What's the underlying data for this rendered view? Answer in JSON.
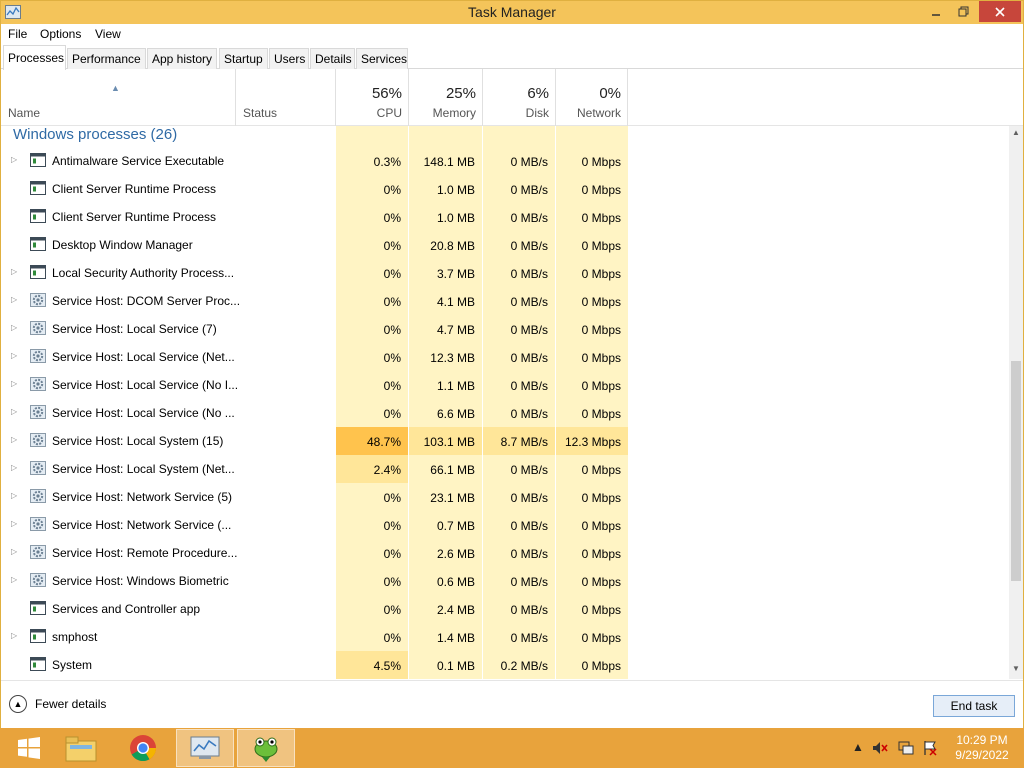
{
  "window": {
    "title": "Task Manager"
  },
  "menu": [
    "File",
    "Options",
    "View"
  ],
  "tabs": [
    "Processes",
    "Performance",
    "App history",
    "Startup",
    "Users",
    "Details",
    "Services"
  ],
  "columns": {
    "name": "Name",
    "status": "Status",
    "cpu": {
      "label": "CPU",
      "pct": "56%"
    },
    "memory": {
      "label": "Memory",
      "pct": "25%"
    },
    "disk": {
      "label": "Disk",
      "pct": "6%"
    },
    "network": {
      "label": "Network",
      "pct": "0%"
    }
  },
  "group": {
    "title": "Windows processes (26)"
  },
  "processes": [
    {
      "name": "Antimalware Service Executable",
      "cpu": "0.3%",
      "memory": "148.1 MB",
      "disk": "0 MB/s",
      "network": "0 Mbps",
      "expandable": true,
      "icon": "window-app-icon"
    },
    {
      "name": "Client Server Runtime Process",
      "cpu": "0%",
      "memory": "1.0 MB",
      "disk": "0 MB/s",
      "network": "0 Mbps",
      "expandable": false,
      "icon": "window-app-icon"
    },
    {
      "name": "Client Server Runtime Process",
      "cpu": "0%",
      "memory": "1.0 MB",
      "disk": "0 MB/s",
      "network": "0 Mbps",
      "expandable": false,
      "icon": "window-app-icon"
    },
    {
      "name": "Desktop Window Manager",
      "cpu": "0%",
      "memory": "20.8 MB",
      "disk": "0 MB/s",
      "network": "0 Mbps",
      "expandable": false,
      "icon": "window-app-icon"
    },
    {
      "name": "Local Security Authority Process...",
      "cpu": "0%",
      "memory": "3.7 MB",
      "disk": "0 MB/s",
      "network": "0 Mbps",
      "expandable": true,
      "icon": "window-app-icon"
    },
    {
      "name": "Service Host: DCOM Server Proc...",
      "cpu": "0%",
      "memory": "4.1 MB",
      "disk": "0 MB/s",
      "network": "0 Mbps",
      "expandable": true,
      "icon": "gear-icon"
    },
    {
      "name": "Service Host: Local Service (7)",
      "cpu": "0%",
      "memory": "4.7 MB",
      "disk": "0 MB/s",
      "network": "0 Mbps",
      "expandable": true,
      "icon": "gear-icon"
    },
    {
      "name": "Service Host: Local Service (Net...",
      "cpu": "0%",
      "memory": "12.3 MB",
      "disk": "0 MB/s",
      "network": "0 Mbps",
      "expandable": true,
      "icon": "gear-icon"
    },
    {
      "name": "Service Host: Local Service (No I...",
      "cpu": "0%",
      "memory": "1.1 MB",
      "disk": "0 MB/s",
      "network": "0 Mbps",
      "expandable": true,
      "icon": "gear-icon"
    },
    {
      "name": "Service Host: Local Service (No ...",
      "cpu": "0%",
      "memory": "6.6 MB",
      "disk": "0 MB/s",
      "network": "0 Mbps",
      "expandable": true,
      "icon": "gear-icon"
    },
    {
      "name": "Service Host: Local System (15)",
      "cpu": "48.7%",
      "memory": "103.1 MB",
      "disk": "8.7 MB/s",
      "network": "12.3 Mbps",
      "expandable": true,
      "icon": "gear-icon",
      "heat": "hot"
    },
    {
      "name": "Service Host: Local System (Net...",
      "cpu": "2.4%",
      "memory": "66.1 MB",
      "disk": "0 MB/s",
      "network": "0 Mbps",
      "expandable": true,
      "icon": "gear-icon"
    },
    {
      "name": "Service Host: Network Service (5)",
      "cpu": "0%",
      "memory": "23.1 MB",
      "disk": "0 MB/s",
      "network": "0 Mbps",
      "expandable": true,
      "icon": "gear-icon"
    },
    {
      "name": "Service Host: Network Service (...",
      "cpu": "0%",
      "memory": "0.7 MB",
      "disk": "0 MB/s",
      "network": "0 Mbps",
      "expandable": true,
      "icon": "gear-icon"
    },
    {
      "name": "Service Host: Remote Procedure...",
      "cpu": "0%",
      "memory": "2.6 MB",
      "disk": "0 MB/s",
      "network": "0 Mbps",
      "expandable": true,
      "icon": "gear-icon"
    },
    {
      "name": "Service Host: Windows Biometric",
      "cpu": "0%",
      "memory": "0.6 MB",
      "disk": "0 MB/s",
      "network": "0 Mbps",
      "expandable": true,
      "icon": "gear-icon"
    },
    {
      "name": "Services and Controller app",
      "cpu": "0%",
      "memory": "2.4 MB",
      "disk": "0 MB/s",
      "network": "0 Mbps",
      "expandable": false,
      "icon": "window-app-icon"
    },
    {
      "name": "smphost",
      "cpu": "0%",
      "memory": "1.4 MB",
      "disk": "0 MB/s",
      "network": "0 Mbps",
      "expandable": true,
      "icon": "window-app-icon"
    },
    {
      "name": "System",
      "cpu": "4.5%",
      "memory": "0.1 MB",
      "disk": "0.2 MB/s",
      "network": "0 Mbps",
      "expandable": false,
      "icon": "window-app-icon"
    }
  ],
  "footer": {
    "fewer_details": "Fewer details",
    "end_task": "End task"
  },
  "taskbar": {
    "items": [
      "windows-start-icon",
      "file-explorer-icon",
      "chrome-icon",
      "task-manager-icon",
      "frog-app-icon"
    ],
    "time": "10:29 PM",
    "date": "9/29/2022"
  },
  "colors": {
    "titlebar": "#f4c45a",
    "taskbar": "#e8a33c",
    "column_bg": "#fff4c4",
    "hot": "#ffc34d",
    "accent": "#2f6aa5"
  }
}
